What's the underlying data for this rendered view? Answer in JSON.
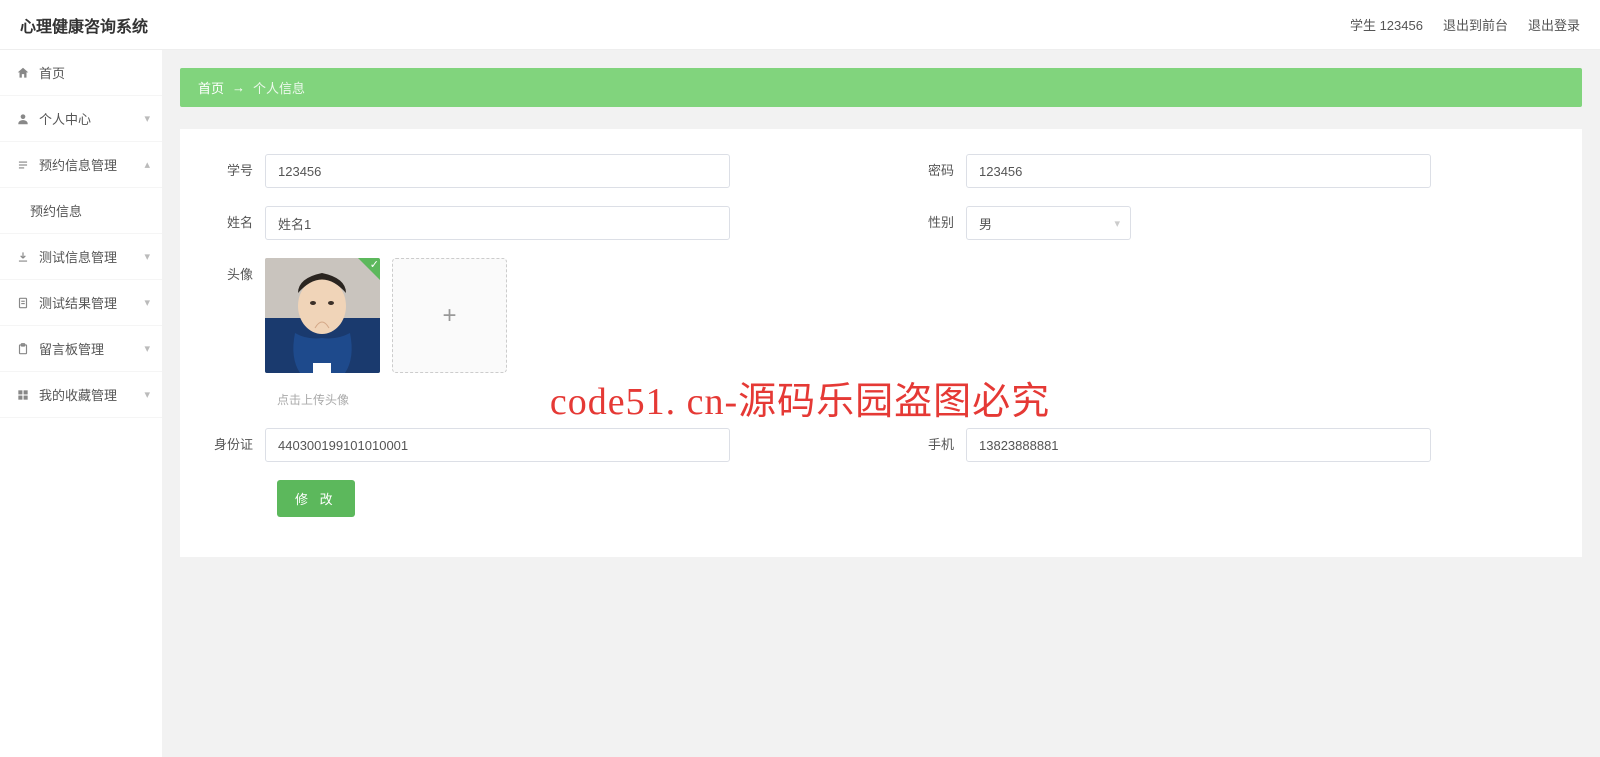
{
  "app": {
    "title": "心理健康咨询系统"
  },
  "header": {
    "user": "学生 123456",
    "frontend": "退出到前台",
    "logout": "退出登录"
  },
  "sidebar": {
    "home": "首页",
    "personal": "个人中心",
    "appointment": "预约信息管理",
    "appointment_sub": "预约信息",
    "test_info": "测试信息管理",
    "test_result": "测试结果管理",
    "message_board": "留言板管理",
    "favorites": "我的收藏管理"
  },
  "breadcrumb": {
    "home": "首页",
    "arrow": "→",
    "current": "个人信息"
  },
  "form": {
    "student_id_label": "学号",
    "student_id_value": "123456",
    "password_label": "密码",
    "password_value": "123456",
    "name_label": "姓名",
    "name_value": "姓名1",
    "gender_label": "性别",
    "gender_value": "男",
    "avatar_label": "头像",
    "upload_hint": "点击上传头像",
    "idcard_label": "身份证",
    "idcard_value": "440300199101010001",
    "phone_label": "手机",
    "phone_value": "13823888881",
    "submit": "修 改"
  },
  "watermark": "code51. cn-源码乐园盗图必究"
}
